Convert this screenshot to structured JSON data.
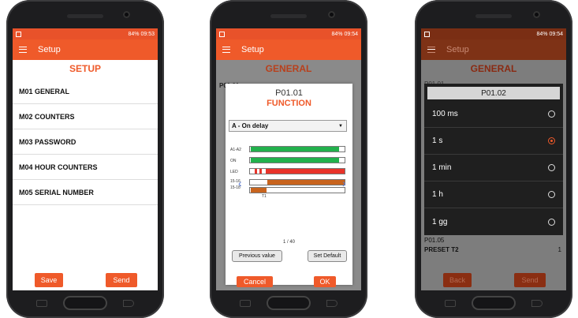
{
  "phone1": {
    "status_time": "09:53",
    "status_battery": "84%",
    "toolbar_title": "Setup",
    "section_title": "SETUP",
    "menu_items": [
      "M01 GENERAL",
      "M02 COUNTERS",
      "M03 PASSWORD",
      "M04 HOUR COUNTERS",
      "M05 SERIAL NUMBER"
    ],
    "save_label": "Save",
    "send_label": "Send"
  },
  "phone2": {
    "status_time": "09:54",
    "status_battery": "84%",
    "toolbar_title": "Setup",
    "section_title": "GENERAL",
    "bg_param_code": "P01.01",
    "dialog_code": "P01.01",
    "dialog_title": "FUNCTION",
    "select_value": "A - On delay",
    "timeline_labels": [
      "A1-A2",
      "ON",
      "LED",
      "15-16",
      "15-18"
    ],
    "timeline_marker": "T1",
    "page_indicator": "1 / 40",
    "previous_label": "Previous value",
    "default_label": "Set Default",
    "cancel_label": "Cancel",
    "ok_label": "OK"
  },
  "phone3": {
    "status_time": "09:54",
    "status_battery": "84%",
    "toolbar_title": "Setup",
    "section_title": "GENERAL",
    "bg_param_code": "P01.01",
    "picker_title": "P01.02",
    "options": [
      "100 ms",
      "1 s",
      "1 min",
      "1 h",
      "1 gg"
    ],
    "selected_index": 1,
    "bg_row_code": "P01.05",
    "bg_row_label": "PRESET T2",
    "bg_row_value": "1",
    "back_label": "Back",
    "send_label": "Send"
  },
  "colors": {
    "accent": "#ef5a2a",
    "green": "#22b14c",
    "red": "#e8332a",
    "brown": "#c8641e"
  }
}
